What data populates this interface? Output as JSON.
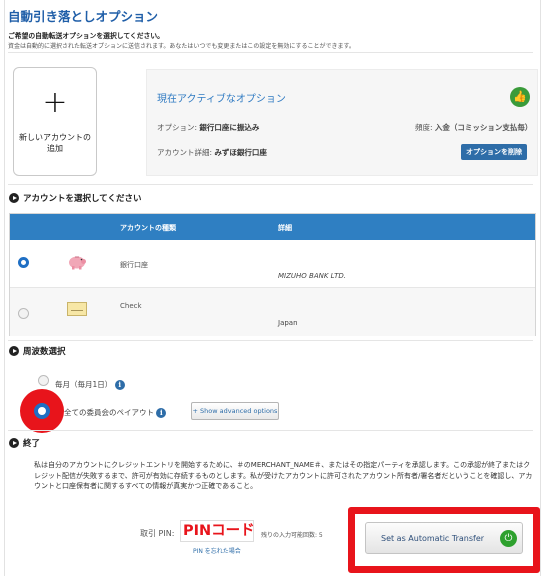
{
  "page": {
    "title": "自動引き落としオプション",
    "intro_line1": "ご希望の自動転送オプションを選択してください。",
    "intro_line2": "資金は自動的に選択された転送オプションに送信されます。あなたはいつでも変更またはこの設定を無効にすることができます。"
  },
  "new_account": {
    "plus": "+",
    "label": "新しいアカウントの追加"
  },
  "active_option": {
    "title": "現在アクティブなオプション",
    "option_label": "オプション: ",
    "option_value": "銀行口座に振込み",
    "account_label": "アカウント詳細: ",
    "account_value": "みずほ銀行口座",
    "frequency_label": "頻度: ",
    "frequency_value": "入金（コミッション支払毎）",
    "delete_button": "オプションを削除",
    "badge_icon": "thumbs-up-icon"
  },
  "account_section": {
    "heading": "アカウントを選択してください",
    "columns": [
      "アカウントの種類",
      "詳細"
    ],
    "rows": [
      {
        "type": "銀行口座",
        "detail": "MIZUHO BANK LTD.",
        "selected": true,
        "icon": "piggy-bank-icon"
      },
      {
        "type": "Check",
        "detail": "Japan",
        "selected": false,
        "icon": "cheque-icon"
      }
    ]
  },
  "frequency_section": {
    "heading": "周波数選択",
    "option_monthly": "毎月（毎月1日）",
    "option_all": "全ての委員会のペイアウト",
    "advanced_button": "+ Show advanced options"
  },
  "finish_section": {
    "heading": "終了",
    "terms": "私は自分のアカウントにクレジットエントリを開始するために、＃のMERCHANT_NAME＃、またはその指定パーティを承認します。この承認が終了またはクレジット配信が失敗するまで、許可が有効に存続するものとします。私が受けたアカウントに許可されたアカウント所有者/署名者だということを確認し、アカウントと口座保有者に関するすべての情報が真実かつ正確であること。"
  },
  "pin": {
    "label": "取引 PIN:",
    "value": "PINコード",
    "forgot": "PIN を忘れた場合",
    "remaining": "残りの入力可能回数: 5"
  },
  "submit": {
    "label": "Set as Automatic Transfer",
    "icon": "power-icon"
  },
  "colors": {
    "accent": "#2f7fc2",
    "highlight": "#e8141b",
    "success": "#3a9b3a"
  }
}
